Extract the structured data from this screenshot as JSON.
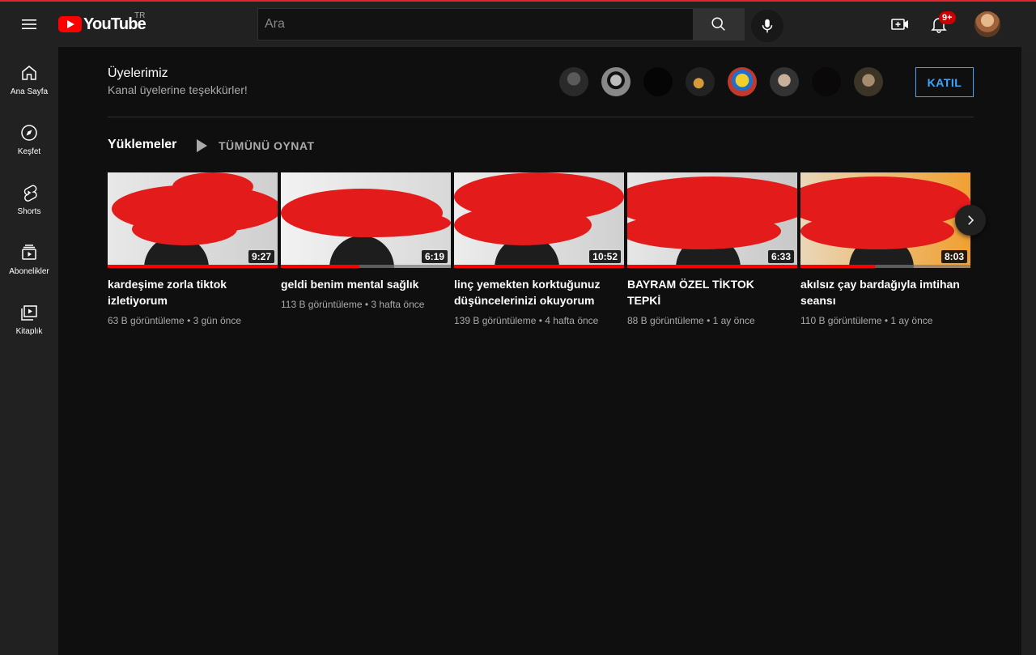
{
  "header": {
    "logo_text": "YouTube",
    "country_code": "TR",
    "search_placeholder": "Ara",
    "notification_count": "9+",
    "icons": [
      "menu-icon",
      "search-icon",
      "mic-icon",
      "create-video-icon",
      "bell-icon"
    ]
  },
  "sidebar": {
    "items": [
      {
        "label": "Ana Sayfa",
        "icon": "home-icon"
      },
      {
        "label": "Keşfet",
        "icon": "compass-icon"
      },
      {
        "label": "Shorts",
        "icon": "shorts-icon"
      },
      {
        "label": "Abonelikler",
        "icon": "subscriptions-icon"
      },
      {
        "label": "Kitaplık",
        "icon": "library-icon"
      }
    ]
  },
  "members": {
    "title": "Üyelerimiz",
    "subtitle": "Kanal üyelerine teşekkürler!",
    "join_label": "KATIL",
    "avatar_count": 8
  },
  "uploads": {
    "title": "Yüklemeler",
    "play_all_label": "TÜMÜNÜ OYNAT",
    "videos": [
      {
        "title": "kardeşime zorla tiktok izletiyorum",
        "duration": "9:27",
        "views": "63 B görüntüleme",
        "age": "3 gün önce",
        "watched_fraction": 1.0
      },
      {
        "title": "geldi benim mental sağlık",
        "duration": "6:19",
        "views": "113 B görüntüleme",
        "age": "3 hafta önce",
        "watched_fraction": 0.46
      },
      {
        "title": "linç yemekten korktuğunuz düşüncelerinizi okuyorum",
        "duration": "10:52",
        "views": "139 B görüntüleme",
        "age": "4 hafta önce",
        "watched_fraction": 1.0
      },
      {
        "title": "BAYRAM ÖZEL TİKTOK TEPKİ",
        "duration": "6:33",
        "views": "88 B görüntüleme",
        "age": "1 ay önce",
        "watched_fraction": 1.0
      },
      {
        "title": "akılsız çay bardağıyla imtihan seansı",
        "duration": "8:03",
        "views": "110 B görüntüleme",
        "age": "1 ay önce",
        "watched_fraction": 0.44
      }
    ]
  },
  "colors": {
    "accent": "#ff0000",
    "join_blue": "#3ea6ff",
    "header_bg": "#212121",
    "page_bg": "#0f0f0f"
  }
}
